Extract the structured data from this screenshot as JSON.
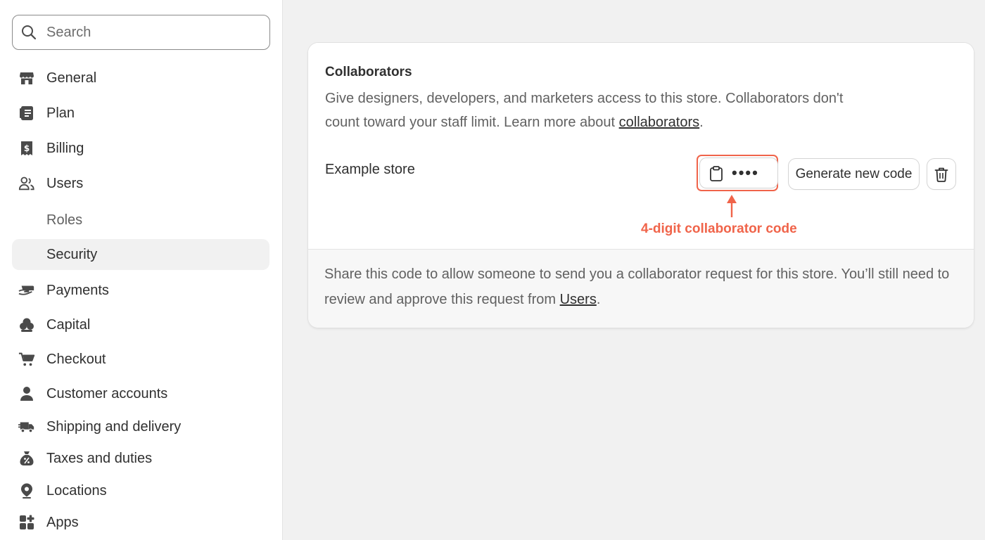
{
  "search": {
    "placeholder": "Search"
  },
  "sidebar": {
    "items": [
      {
        "label": "General",
        "icon": "store-icon"
      },
      {
        "label": "Plan",
        "icon": "plan-icon"
      },
      {
        "label": "Billing",
        "icon": "billing-icon"
      },
      {
        "label": "Users",
        "icon": "users-icon"
      },
      {
        "label": "Roles",
        "icon": "",
        "sub": true
      },
      {
        "label": "Security",
        "icon": "",
        "sub": true,
        "selected": true
      },
      {
        "label": "Payments",
        "icon": "payments-icon"
      },
      {
        "label": "Capital",
        "icon": "capital-icon"
      },
      {
        "label": "Checkout",
        "icon": "cart-icon"
      },
      {
        "label": "Customer accounts",
        "icon": "person-icon"
      },
      {
        "label": "Shipping and delivery",
        "icon": "truck-icon"
      },
      {
        "label": "Taxes and duties",
        "icon": "tax-icon"
      },
      {
        "label": "Locations",
        "icon": "location-icon"
      },
      {
        "label": "Apps",
        "icon": "apps-icon"
      }
    ]
  },
  "collaborators": {
    "title": "Collaborators",
    "description_prefix": "Give designers, developers, and marketers access to this store. Collaborators don't count toward your staff limit. Learn more about ",
    "description_link": "collaborators",
    "description_suffix": ".",
    "store_name": "Example store",
    "code_masked": "••••",
    "generate_label": "Generate new code",
    "annotation": "4-digit collaborator code",
    "footer_prefix": "Share this code to allow someone to send you a collaborator request for this store. You’ll still need to review and approve this request from ",
    "footer_link": "Users",
    "footer_suffix": "."
  },
  "colors": {
    "accent_annotation": "#f0644a",
    "background": "#f1f1f1",
    "text": "#303030",
    "muted_text": "#616161"
  }
}
